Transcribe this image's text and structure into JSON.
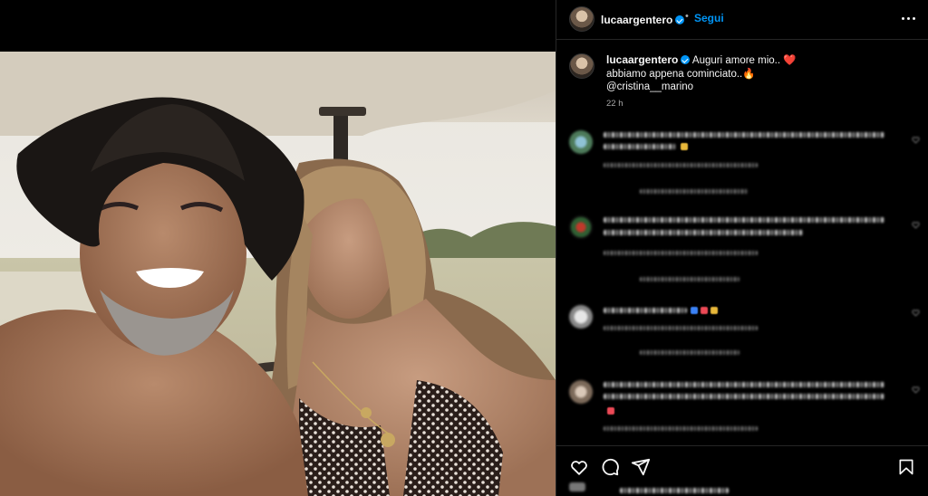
{
  "header": {
    "username": "lucaargentero",
    "separator": "•",
    "follow_label": "Segui"
  },
  "caption": {
    "username": "lucaargentero",
    "line1": "Auguri amore mio..",
    "line1_emoji": "❤️",
    "line2": "abbiamo appena cominciato..",
    "line2_emoji": "🔥",
    "mention": "@cristina__marino",
    "time": "22 h"
  },
  "icons": {
    "verified": "verified-badge-icon",
    "more": "more-options-icon",
    "like": "heart-icon",
    "comment": "comment-icon",
    "share": "share-icon",
    "save": "bookmark-icon"
  },
  "colors": {
    "accent": "#0095f6",
    "background": "#000000",
    "text": "#f5f5f5",
    "muted": "#a8a8a8"
  }
}
